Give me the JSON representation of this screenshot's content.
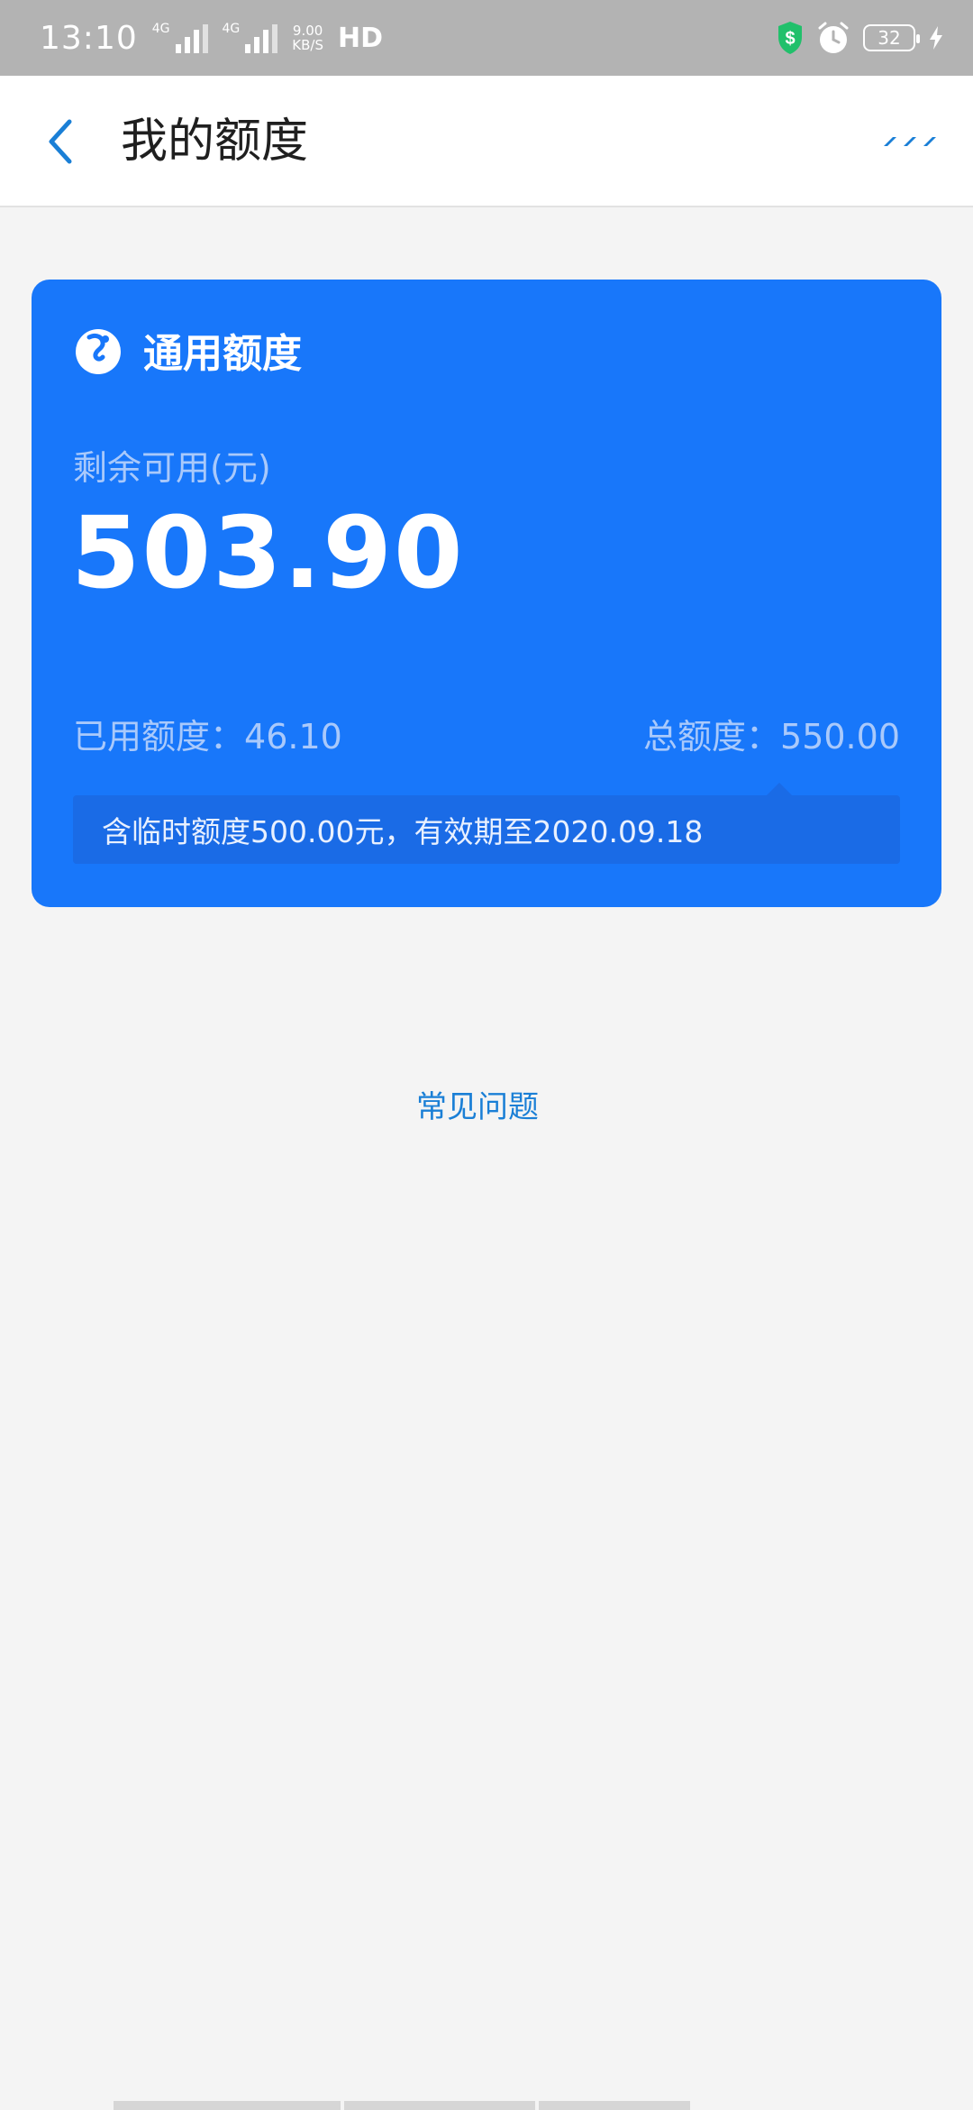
{
  "status_bar": {
    "time": "13:10",
    "network_1": "4G",
    "network_2": "4G",
    "speed_value": "9.00",
    "speed_unit": "KB/S",
    "hd": "HD",
    "battery": "32",
    "icons": [
      "security-shield-icon",
      "alarm-icon",
      "battery-icon",
      "charging-bolt-icon"
    ]
  },
  "nav": {
    "title": "我的额度",
    "back_icon": "chevron-left-icon",
    "more_icon": "more-dots-icon"
  },
  "card": {
    "title": "通用额度",
    "logo_icon": "brand-logo-icon",
    "remaining_label": "剩余可用(元)",
    "remaining_amount": "503.90",
    "used_label": "已用额度：",
    "used_value": "46.10",
    "total_label": "总额度：",
    "total_value": "550.00",
    "temp_note": "含临时额度500.00元，有效期至2020.09.18"
  },
  "faq": {
    "label": "常见问题"
  },
  "colors": {
    "accent": "#1877fa",
    "link": "#1a7fd6",
    "background": "#f4f4f4"
  }
}
